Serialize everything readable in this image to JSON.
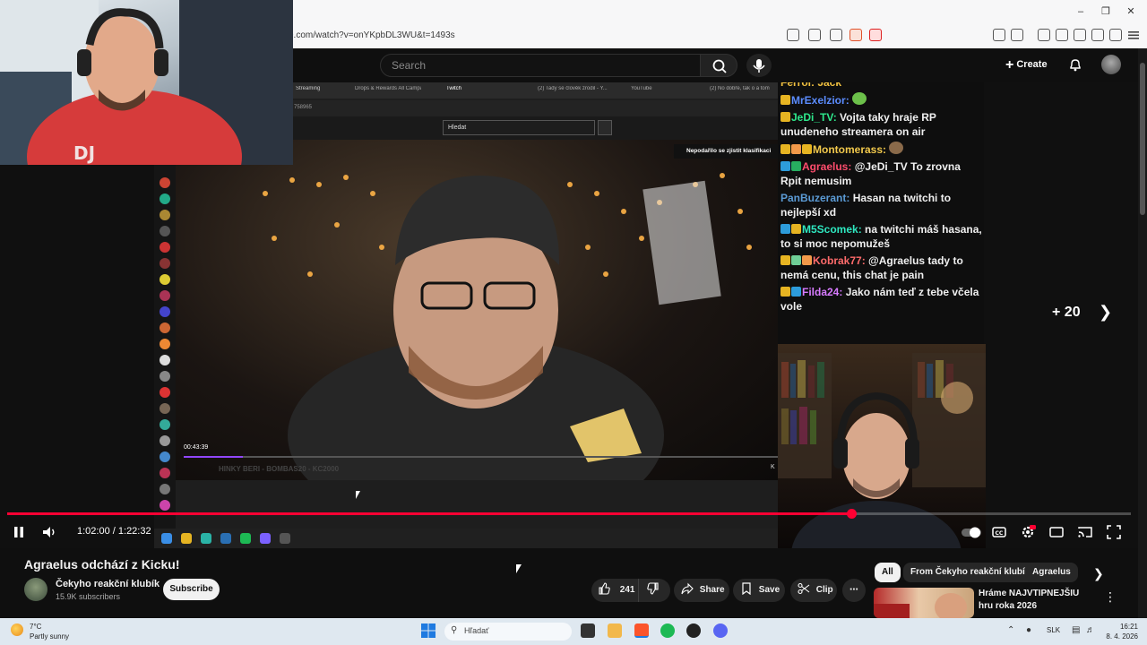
{
  "browser": {
    "url": "e.com/watch?v=onYKpbDL3WU&t=1493s"
  },
  "yt": {
    "search_placeholder": "Search",
    "create_label": "Create"
  },
  "inner_browser": {
    "tabs": [
      "Streaming",
      "Drops & Rewards All Campa",
      "Twitch",
      "(2) Tady se člověk zrodil - Y...",
      "YouTube",
      "(2) No dobře, tak o a tom"
    ],
    "url_fragment": "758965",
    "search_value": "Hledat",
    "warning": "Nepodařilo se zjistit klasifikaci",
    "time": "00:43:39",
    "stream_caption": "HINKY BERI - BOMBAS20 - KC2000",
    "right_label": "K"
  },
  "chat": {
    "top_partial": "Ferrol: Jack",
    "messages": [
      {
        "user": "MrExelzior",
        "text": "",
        "color": "#5b8cff",
        "badges": [
          "#e6b422"
        ]
      },
      {
        "user": "JeDi_TV",
        "text": "Vojta taky hraje RP unudeneho streamera on air",
        "color": "#2ee88c",
        "badges": [
          "#e6b422"
        ]
      },
      {
        "user": "Montomerass",
        "text": "",
        "color": "#f2c94c",
        "badges": [
          "#e6b422",
          "#f2994a",
          "#e6b422"
        ]
      },
      {
        "user": "Agraelus",
        "text": "@JeDi_TV To zrovna Rpit nemusim",
        "color": "#ff4d6d",
        "badges": [
          "#2d9cdb",
          "#27ae60"
        ]
      },
      {
        "user": "PanBuzerant",
        "text": "Hasan na twitchi to nejlepší xd",
        "color": "#5b9bd5",
        "badges": []
      },
      {
        "user": "M5Scomek",
        "text": "na twitchi máš hasana, to si moc nepomužeš",
        "color": "#2ee8c0",
        "badges": [
          "#2d9cdb",
          "#e6b422"
        ]
      },
      {
        "user": "Kobrak77",
        "text": "@Agraelus tady to nemá cenu, this chat je pain",
        "color": "#ff6b6b",
        "badges": [
          "#e6b422",
          "#6fcf97",
          "#f2994a"
        ]
      },
      {
        "user": "Filda24",
        "text": "Jako nám teď z tebe včela vole",
        "color": "#d77bff",
        "badges": [
          "#e6b422",
          "#2d9cdb"
        ]
      }
    ],
    "more_count": "+ 20"
  },
  "player": {
    "time_current": "1:02:00",
    "time_total": "1:22:32",
    "progress_fraction": 0.751
  },
  "video": {
    "title": "Agraelus odchází z Kicku!",
    "channel": "Čekyho reakční klubík",
    "subscribers": "15.9K subscribers",
    "subscribe_label": "Subscribe",
    "likes": "241",
    "share_label": "Share",
    "save_label": "Save",
    "clip_label": "Clip"
  },
  "sidebar": {
    "chips": [
      "All",
      "From Čekyho reakční klubík",
      "Agraelus"
    ],
    "rec_title": "Hráme NAJVTIPNEJŠIU hru roka 2026"
  },
  "taskbar": {
    "temp": "7°C",
    "weather": "Partly sunny",
    "search_placeholder": "Hľadať",
    "lang": "SLK",
    "time": "16:21",
    "date": "8. 4. 2026"
  }
}
